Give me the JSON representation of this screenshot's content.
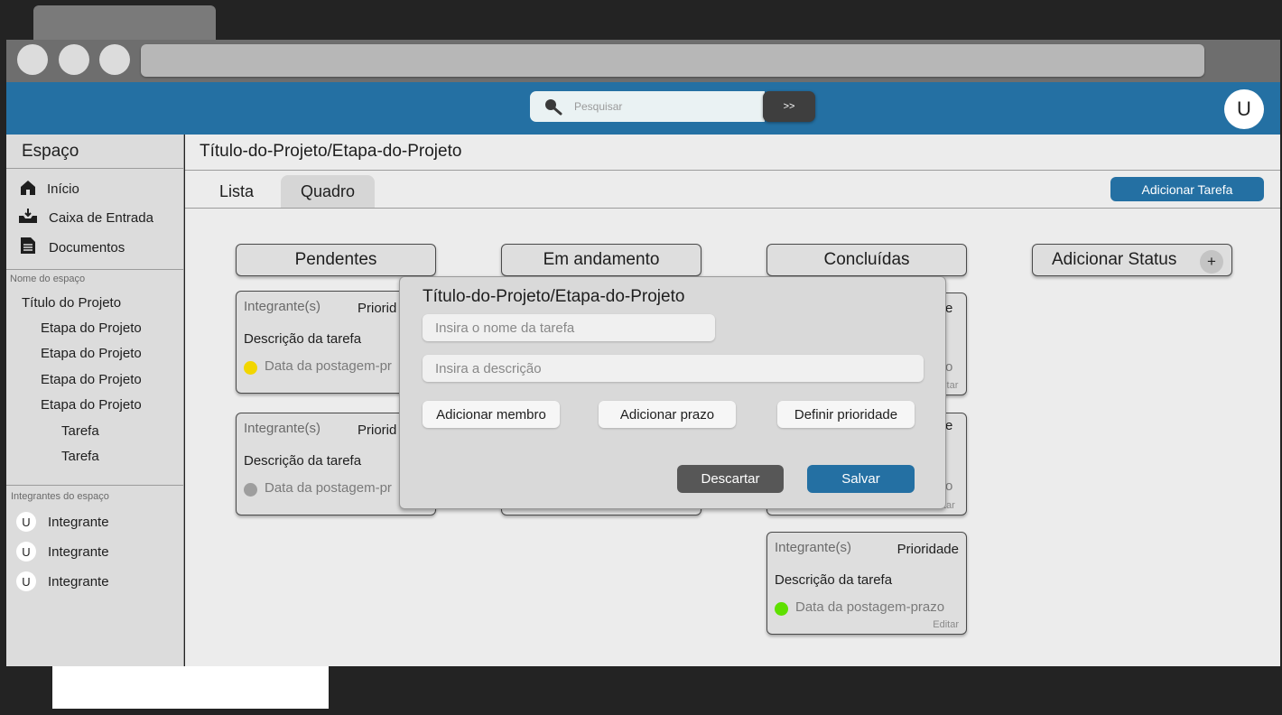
{
  "header": {
    "search_placeholder": "Pesquisar",
    "search_button": ">>",
    "user_initial": "U"
  },
  "sidebar": {
    "title": "Espaço",
    "nav": [
      {
        "label": "Início",
        "icon": "home-icon"
      },
      {
        "label": "Caixa de Entrada",
        "icon": "inbox-icon"
      },
      {
        "label": "Documentos",
        "icon": "document-icon"
      }
    ],
    "space_name_label": "Nome do espaço",
    "project": "Título do Projeto",
    "stages": [
      "Etapa do Projeto",
      "Etapa do Projeto",
      "Etapa do Projeto",
      "Etapa do Projeto"
    ],
    "tasks": [
      "Tarefa",
      "Tarefa"
    ],
    "members_label": "Integrantes do espaço",
    "members": [
      {
        "initial": "U",
        "name": "Integrante"
      },
      {
        "initial": "U",
        "name": "Integrante"
      },
      {
        "initial": "U",
        "name": "Integrante"
      }
    ]
  },
  "main": {
    "title": "Título-do-Projeto/Etapa-do-Projeto",
    "tabs": [
      "Lista",
      "Quadro"
    ],
    "add_task": "Adicionar Tarefa",
    "columns": [
      "Pendentes",
      "Em andamento",
      "Concluídas"
    ],
    "add_status": "Adicionar Status",
    "add_status_plus": "+",
    "cards": {
      "pendentes": [
        {
          "members": "Integrante(s)",
          "priority_partial": "Priorid",
          "desc": "Descrição da tarefa",
          "date_partial": "Data da postagem-pr",
          "dot_color": "#f2d600"
        },
        {
          "members": "Integrante(s)",
          "priority_partial": "Priorid",
          "desc": "Descrição da tarefa",
          "date_partial": "Data da postagem-pr",
          "dot_color": "#9e9e9e",
          "edit_partial": "Editar"
        }
      ],
      "concluidas_partial": [
        {
          "prio_tail": "e",
          "date_tail": "o",
          "edit_tail": "ditar"
        },
        {
          "prio_tail": "e",
          "date_tail": "o",
          "edit_tail": "Editar"
        }
      ],
      "concluidas_full": {
        "members": "Integrante(s)",
        "priority": "Prioridade",
        "desc": "Descrição da tarefa",
        "date": "Data da postagem-prazo",
        "dot_color": "#5ee000",
        "edit": "Editar"
      }
    }
  },
  "modal": {
    "title": "Título-do-Projeto/Etapa-do-Projeto",
    "name_placeholder": "Insira o nome da tarefa",
    "desc_placeholder": "Insira a descrição",
    "add_member": "Adicionar membro",
    "add_deadline": "Adicionar prazo",
    "set_priority": "Definir prioridade",
    "discard": "Descartar",
    "save": "Salvar"
  },
  "colors": {
    "accent": "#2470a3",
    "header_bg": "#2470a3",
    "dark_button": "#575757"
  }
}
